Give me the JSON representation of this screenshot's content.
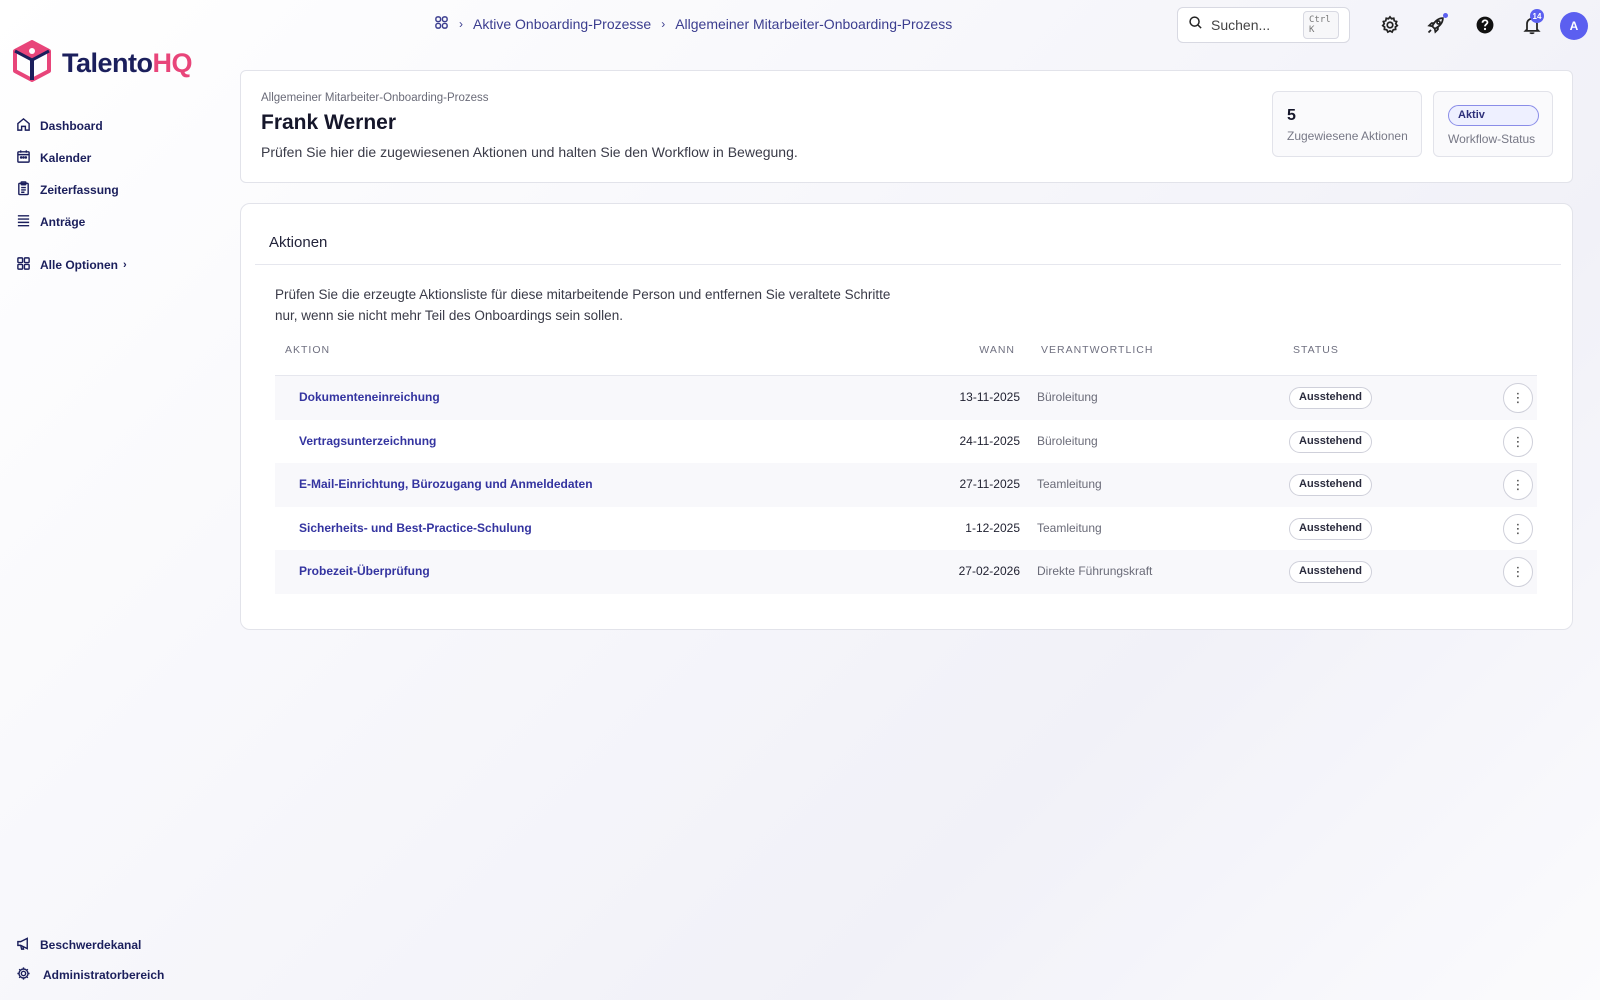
{
  "brand": {
    "name_part1": "Talento",
    "name_part2": "HQ",
    "colors": {
      "primary": "#1b1f5c",
      "accent": "#e8457a",
      "highlight": "#5b5ff0"
    }
  },
  "sidebar": {
    "items": [
      {
        "label": "Dashboard",
        "icon": "home-icon"
      },
      {
        "label": "Kalender",
        "icon": "calendar-icon"
      },
      {
        "label": "Zeiterfassung",
        "icon": "clipboard-icon"
      },
      {
        "label": "Anträge",
        "icon": "list-icon"
      }
    ],
    "all_options": "Alle Optionen",
    "bottom": [
      {
        "label": "Beschwerdekanal",
        "icon": "megaphone-icon"
      },
      {
        "label": "Administratorbereich",
        "icon": "gear-icon"
      }
    ]
  },
  "breadcrumb": {
    "items": [
      "Aktive Onboarding-Prozesse",
      "Allgemeiner Mitarbeiter-Onboarding-Prozess"
    ]
  },
  "search": {
    "placeholder": "Suchen...",
    "shortcut": "Ctrl K"
  },
  "topbar": {
    "notification_count": "14",
    "avatar_initial": "A"
  },
  "header": {
    "process_name": "Allgemeiner Mitarbeiter-Onboarding-Prozess",
    "employee_name": "Frank Werner",
    "description": "Prüfen Sie hier die zugewiesenen Aktionen und halten Sie den Workflow in Bewegung.",
    "assigned_count": "5",
    "assigned_label": "Zugewiesene Aktionen",
    "status_value": "Aktiv",
    "status_label": "Workflow-Status"
  },
  "actions": {
    "title": "Aktionen",
    "description": "Prüfen Sie die erzeugte Aktionsliste für diese mitarbeitende Person und entfernen Sie veraltete Schritte nur, wenn sie nicht mehr Teil des Onboardings sein sollen.",
    "columns": {
      "action": "AKTION",
      "when": "WANN",
      "responsible": "VERANTWORTLICH",
      "status": "STATUS"
    },
    "rows": [
      {
        "action": "Dokumenteneinreichung",
        "when": "13-11-2025",
        "responsible": "Büroleitung",
        "status": "Ausstehend"
      },
      {
        "action": "Vertragsunterzeichnung",
        "when": "24-11-2025",
        "responsible": "Büroleitung",
        "status": "Ausstehend"
      },
      {
        "action": "E-Mail-Einrichtung, Bürozugang und Anmeldedaten",
        "when": "27-11-2025",
        "responsible": "Teamleitung",
        "status": "Ausstehend"
      },
      {
        "action": "Sicherheits- und Best-Practice-Schulung",
        "when": "1-12-2025",
        "responsible": "Teamleitung",
        "status": "Ausstehend"
      },
      {
        "action": "Probezeit-Überprüfung",
        "when": "27-02-2026",
        "responsible": "Direkte Führungskraft",
        "status": "Ausstehend"
      }
    ]
  }
}
